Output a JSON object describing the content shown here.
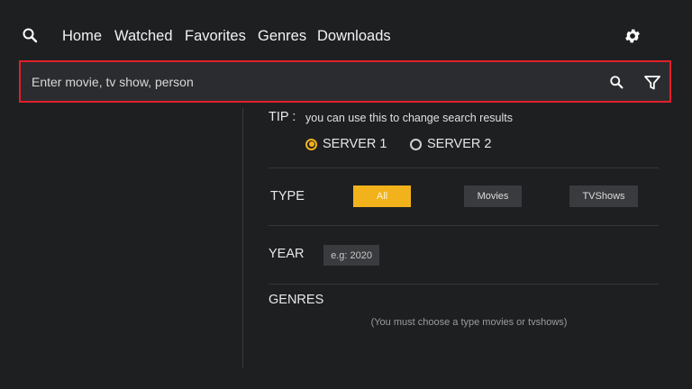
{
  "nav": {
    "items": [
      {
        "label": "Home"
      },
      {
        "label": "Watched"
      },
      {
        "label": "Favorites"
      },
      {
        "label": "Genres"
      },
      {
        "label": "Downloads"
      }
    ],
    "search_icon": "search-icon",
    "settings_icon": "gear-icon"
  },
  "search": {
    "placeholder": "Enter movie, tv show, person",
    "value": "",
    "search_icon": "search-icon",
    "filter_icon": "filter-icon"
  },
  "filters": {
    "tip_label": "TIP :",
    "tip_text": "you can use this to change search results",
    "servers": [
      {
        "label": "SERVER 1",
        "selected": true
      },
      {
        "label": "SERVER 2",
        "selected": false
      }
    ],
    "type": {
      "label": "TYPE",
      "options": [
        {
          "label": "All",
          "active": true
        },
        {
          "label": "Movies",
          "active": false
        },
        {
          "label": "TVShows",
          "active": false
        }
      ]
    },
    "year": {
      "label": "YEAR",
      "placeholder": "e.g: 2020"
    },
    "genres": {
      "label": "GENRES",
      "note": "(You must choose a type movies or tvshows)"
    }
  },
  "colors": {
    "accent": "#f2b21c",
    "focus_border": "#e0202a",
    "background": "#1e1f21"
  }
}
